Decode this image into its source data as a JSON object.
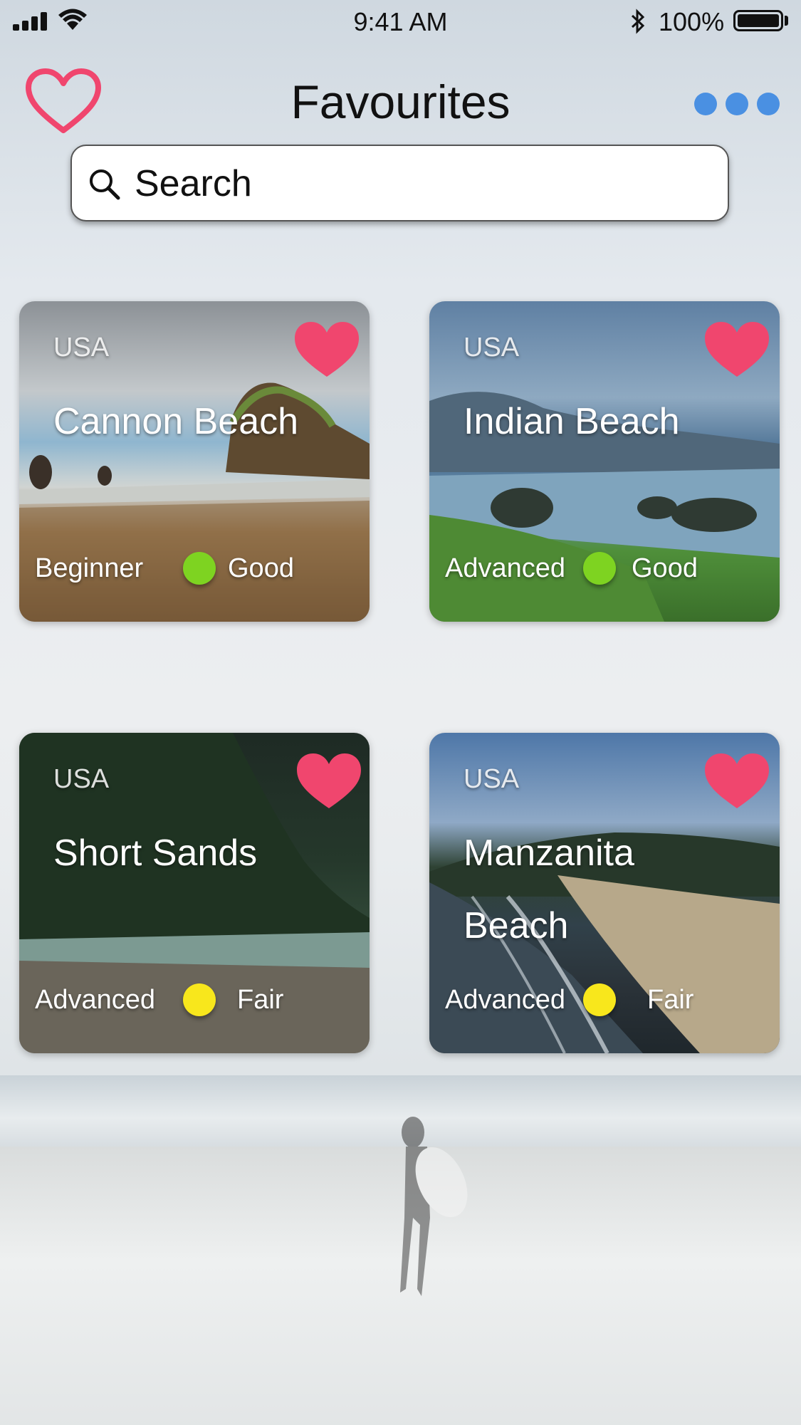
{
  "status_bar": {
    "time": "9:41 AM",
    "battery": "100%"
  },
  "header": {
    "title": "Favourites"
  },
  "search": {
    "placeholder": "Search"
  },
  "colors": {
    "heart": "#f0466e",
    "accent": "#4a90e2",
    "good": "#7ed321",
    "fair": "#f8e71c"
  },
  "cards": [
    {
      "country": "USA",
      "name": "Cannon Beach",
      "level": "Beginner",
      "condition": "Good",
      "condition_color": "good"
    },
    {
      "country": "USA",
      "name": "Indian Beach",
      "level": "Advanced",
      "condition": "Good",
      "condition_color": "good"
    },
    {
      "country": "USA",
      "name": "Short Sands",
      "level": "Advanced",
      "condition": "Fair",
      "condition_color": "fair"
    },
    {
      "country": "USA",
      "name": "Manzanita Beach",
      "level": "Advanced",
      "condition": "Fair",
      "condition_color": "fair"
    }
  ]
}
